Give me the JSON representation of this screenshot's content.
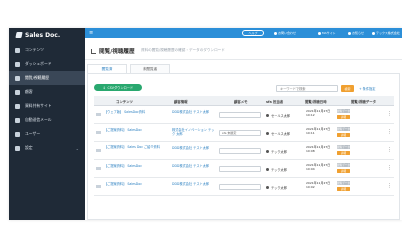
{
  "brand": {
    "name": "Sales Doc."
  },
  "sidebar": {
    "items": [
      {
        "label": "コンテンツ"
      },
      {
        "label": "ダッシュボード"
      },
      {
        "label": "閲覧/視聴履歴"
      },
      {
        "label": "顧客"
      },
      {
        "label": "資料共有サイト"
      },
      {
        "label": "自動送信メール"
      },
      {
        "label": "ユーザー"
      },
      {
        "label": "設定"
      }
    ]
  },
  "topbar": {
    "menu_icon": "≡",
    "help_label": "ヘルプ",
    "items": [
      {
        "label": "お問い合わせ"
      },
      {
        "label": "MAサイト"
      },
      {
        "label": "お知らせ"
      },
      {
        "label": "テックス株式会社"
      }
    ]
  },
  "page": {
    "title": "閲覧/視聴履歴",
    "subtitle": "資料の閲覧/視聴履歴の確認・データのダウンロード",
    "tabs": [
      {
        "label": "閲覧済"
      },
      {
        "label": "未閲覧者"
      }
    ]
  },
  "toolbar": {
    "download_label": "CSVダウンロード",
    "search_placeholder": "キーワードで検索",
    "search_button": "検索",
    "conditions_link": "+ 条件指定"
  },
  "table": {
    "headers": [
      "コンテンツ",
      "顧客情報",
      "顧客メモ",
      "sfa 担当者",
      "閲覧/視聴日時",
      "閲覧/視聴データ"
    ],
    "rows": [
      {
        "content": "【ウェブ版】 SalesDoc資料",
        "customer": "DDD株式会社 テスト太郎",
        "memo": "",
        "owner": "セールス太郎",
        "date": "2021年11月27日",
        "time": "10:12"
      },
      {
        "content": "【ご提案資料】 SalesDoc",
        "customer": "株式会社イノベーション テック 太郎",
        "memo": "sfa 未確定",
        "owner": "セールス太郎",
        "date": "2021年11月27日",
        "time": "10:11"
      },
      {
        "content": "【ご提案資料】 Sales Doc ご紹介資料",
        "customer": "DDD株式会社 テスト太郎",
        "memo": "",
        "owner": "テック太郎",
        "date": "2021年11月27日",
        "time": "10:08"
      },
      {
        "content": "【ご提案資料】 SalesDoc",
        "customer": "DDD株式会社 テスト太郎",
        "memo": "",
        "owner": "テック太郎",
        "date": "2021年11月27日",
        "time": "10:04"
      },
      {
        "content": "【ご提案資料】 SalesDoc",
        "customer": "DDD株式会社 テスト太郎",
        "memo": "",
        "owner": "テック太郎",
        "date": "2021年11月27日",
        "time": "10:02"
      }
    ],
    "badge_label": "閲覧データ",
    "badge_label_2": "詳細"
  },
  "colors": {
    "sidebar_bg": "#1f2a37",
    "topbar_bg": "#2c8fd8",
    "primary_button": "#29a86f",
    "accent_orange": "#f0a030",
    "link": "#2a7fc0"
  }
}
